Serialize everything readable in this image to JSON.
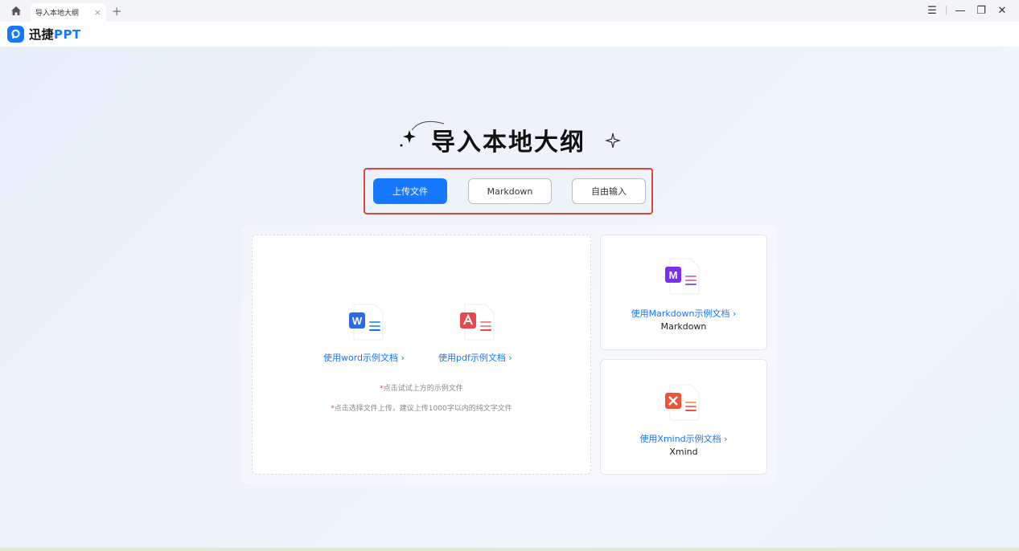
{
  "window": {
    "tab_title": "导入本地大纲",
    "tab_close": "×",
    "new_tab": "+",
    "menu_glyph": "☰",
    "minimize_glyph": "—",
    "restore_glyph": "❐",
    "close_glyph": "✕"
  },
  "app": {
    "logo_text_main": "迅捷",
    "logo_text_ppt": "PPT",
    "brand_color": "#1677ff"
  },
  "page": {
    "title": "导入本地大纲"
  },
  "modes": {
    "upload": "上传文件",
    "markdown": "Markdown",
    "free_input": "自由输入",
    "active": "upload"
  },
  "upload_card": {
    "word_link": "使用word示例文档 ›",
    "pdf_link": "使用pdf示例文档 ›",
    "hint1_star": "*",
    "hint1": "点击试试上方的示例文件",
    "hint2_star": "*",
    "hint2": "点击选择文件上传，建议上传1000字以内的纯文字文件"
  },
  "markdown_card": {
    "link": "使用Markdown示例文档 ›",
    "label": "Markdown"
  },
  "xmind_card": {
    "link": "使用Xmind示例文档 ›",
    "label": "Xmind"
  },
  "icons": {
    "word": "word-doc-icon",
    "pdf": "pdf-doc-icon",
    "markdown": "markdown-doc-icon",
    "xmind": "xmind-doc-icon"
  }
}
